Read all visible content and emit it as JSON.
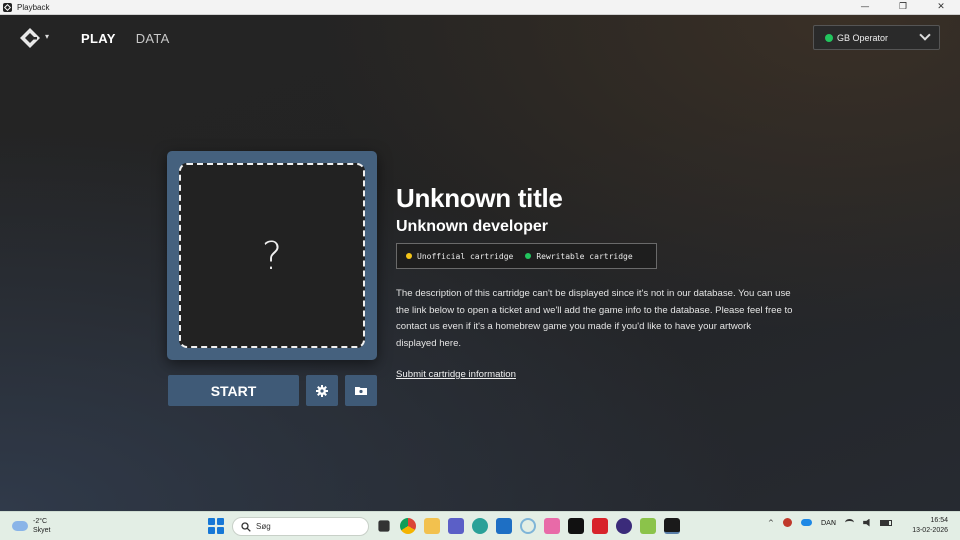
{
  "window": {
    "title": "Playback",
    "minimize": "—",
    "restore": "❐",
    "close": "✕"
  },
  "nav": {
    "logo_caret": "▾",
    "items": [
      {
        "label": "PLAY"
      },
      {
        "label": "DATA"
      }
    ]
  },
  "device": {
    "label": "GB Operator",
    "status_color": "#22c55e"
  },
  "art": {
    "placeholder": "?"
  },
  "actions": {
    "start_label": "START"
  },
  "game": {
    "title": "Unknown title",
    "developer": "Unknown developer",
    "badges": [
      {
        "label": "Unofficial cartridge",
        "color": "#f5c518"
      },
      {
        "label": "Rewritable cartridge",
        "color": "#22c55e"
      }
    ],
    "description": "The description of this cartridge can't be displayed since it's not in our database. You can use the link below to open a ticket and we'll add the game info to the database. Please feel free to contact us even if it's a homebrew game you made if you'd like to have your artwork displayed here.",
    "submit_link": "Submit cartridge information"
  },
  "taskbar": {
    "weather_temp": "-2°C",
    "weather_desc": "Skyet",
    "search_placeholder": "Søg",
    "language": "DAN",
    "time": "16:54",
    "date": "13-02-2026",
    "tray_caret": "^"
  },
  "colors": {
    "accent": "#3f5a77",
    "art_frame": "#45617e"
  }
}
